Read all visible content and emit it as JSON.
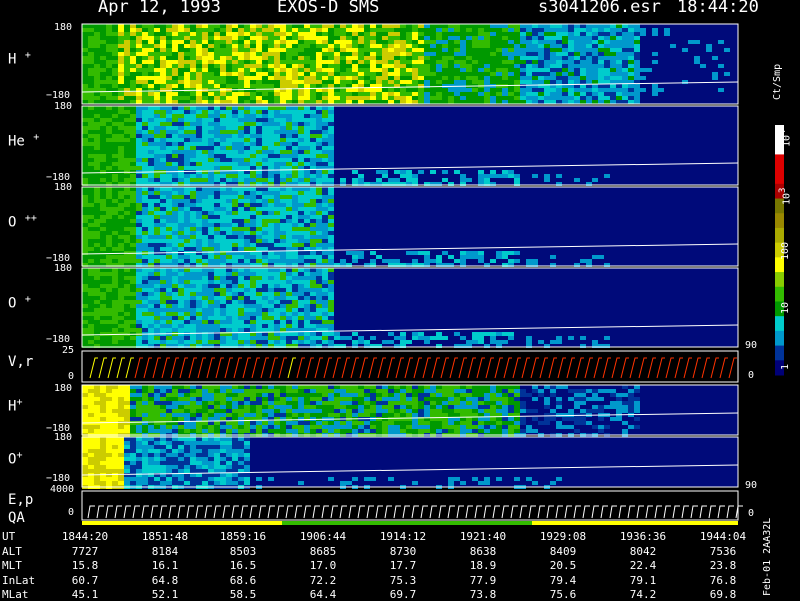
{
  "header": {
    "date": "Apr 12, 1993",
    "instrument": "EXOS-D SMS",
    "file": "s3041206.esr",
    "time": "18:44:20"
  },
  "chart_data": {
    "type": "heatmap",
    "spectrogram_panels": [
      {
        "name": "H+",
        "ymax": "180",
        "ymin": "−180"
      },
      {
        "name": "He+",
        "ymax": "180",
        "ymin": "−180"
      },
      {
        "name": "O++",
        "ymax": "180",
        "ymin": "−180"
      },
      {
        "name": "O+",
        "ymax": "180",
        "ymin": "−180"
      }
    ],
    "vr_panel": {
      "name": "V,r",
      "ymax": "25",
      "ymin": "0",
      "right_top": "90",
      "right_bottom": "0"
    },
    "lower_panels": [
      {
        "name": "H+",
        "ymax": "180",
        "ymin": "−180"
      },
      {
        "name": "O+",
        "ymax": "180",
        "ymin": "−180"
      }
    ],
    "ep_panel": {
      "name1": "E,p",
      "name2": "QA",
      "ymax": "4000",
      "ymin": "0",
      "right_top": "90",
      "right_bottom": "0"
    },
    "colorbar": {
      "unit": "Ct/Smp",
      "ticks": [
        {
          "base": "10",
          "exp": "4"
        },
        {
          "base": "10",
          "exp": "3"
        },
        {
          "base": "100",
          "exp": ""
        },
        {
          "base": "10",
          "exp": ""
        },
        {
          "base": "1",
          "exp": ""
        }
      ],
      "colors": [
        "#ffffff",
        "#ffffff",
        "#dd0000",
        "#dd0000",
        "#aa0000",
        "#777700",
        "#998800",
        "#aaaa00",
        "#cccc00",
        "#ffff00",
        "#88cc00",
        "#33bb00",
        "#009900",
        "#00cccc",
        "#0099cc",
        "#003399",
        "#000077"
      ]
    },
    "time_axis": {
      "rows": [
        {
          "label": "UT",
          "values": [
            "1844:20",
            "1851:48",
            "1859:16",
            "1906:44",
            "1914:12",
            "1921:40",
            "1929:08",
            "1936:36",
            "1944:04"
          ]
        },
        {
          "label": "ALT",
          "values": [
            "7727",
            "8184",
            "8503",
            "8685",
            "8730",
            "8638",
            "8409",
            "8042",
            "7536"
          ]
        },
        {
          "label": "MLT",
          "values": [
            "15.8",
            "16.1",
            "16.5",
            "17.0",
            "17.7",
            "18.9",
            "20.5",
            "22.4",
            "23.8"
          ]
        },
        {
          "label": "InLat",
          "values": [
            "60.7",
            "64.8",
            "68.6",
            "72.2",
            "75.3",
            "77.9",
            "79.4",
            "79.1",
            "76.8"
          ]
        },
        {
          "label": "MLat",
          "values": [
            "45.1",
            "52.1",
            "58.5",
            "64.4",
            "69.7",
            "73.8",
            "75.6",
            "74.2",
            "69.8"
          ]
        }
      ]
    },
    "side_label": "Feb-01 2AA32L"
  }
}
